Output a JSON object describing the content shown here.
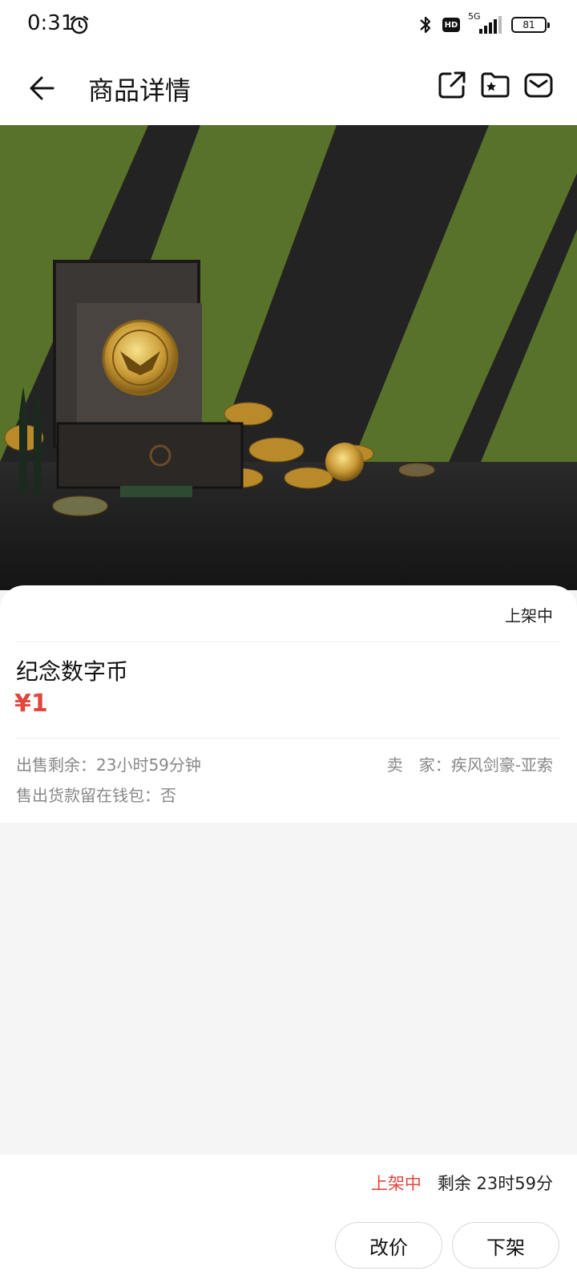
{
  "status_bar": {
    "time": "0:31",
    "network": "5G",
    "hd": "HD",
    "battery": "81"
  },
  "header": {
    "title": "商品详情",
    "icons": [
      "back-arrow-icon",
      "share-icon",
      "favorite-folder-icon",
      "message-icon"
    ]
  },
  "product": {
    "listing_status": "上架中",
    "name": "纪念数字币",
    "price": "¥1",
    "sale_remaining": "出售剩余：23小时59分钟",
    "seller": "卖　家：疾风剑豪-亚索",
    "proceeds_to_wallet": "售出货款留在钱包：否"
  },
  "bottom_bar": {
    "status": "上架中",
    "remaining": "剩余 23时59分",
    "change_price_label": "改价",
    "delist_label": "下架"
  },
  "colors": {
    "accent_red": "#e2463c",
    "hero_green": "#5d7a2a",
    "hero_dark": "#232323"
  }
}
